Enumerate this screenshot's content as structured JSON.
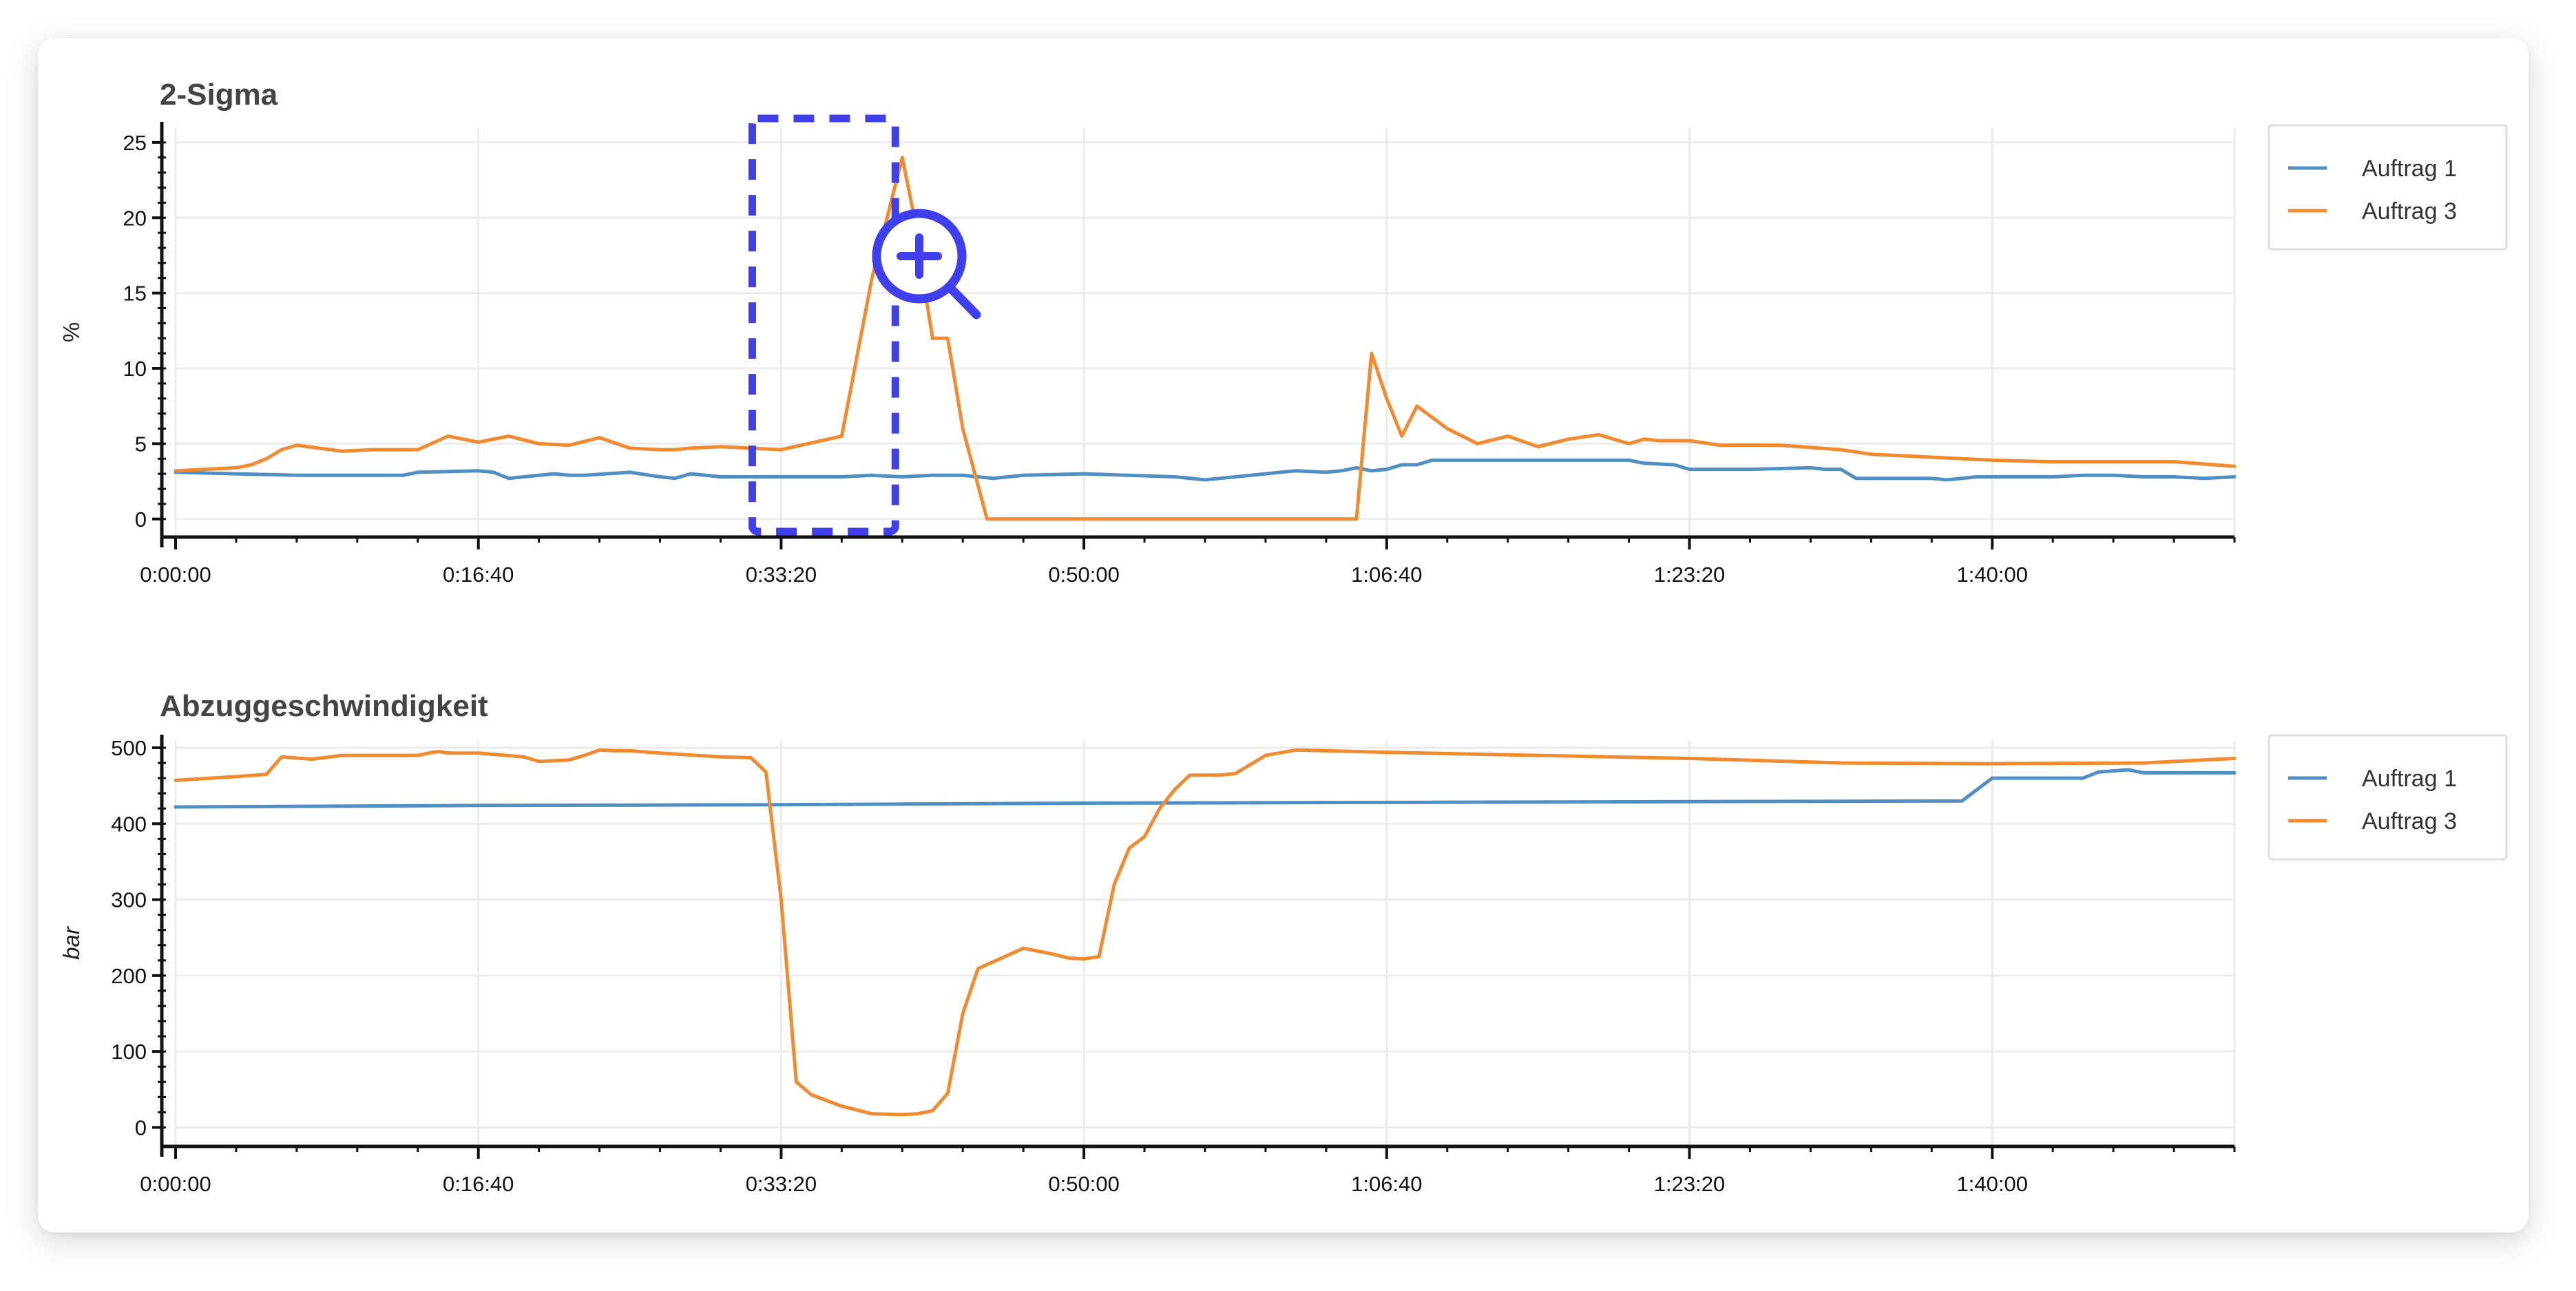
{
  "colors": {
    "series": [
      "#4f8fc4",
      "#f28a30"
    ],
    "grid": "#ececec",
    "axis": "#111111",
    "zoom_overlay": "#3f3fee"
  },
  "icons": [
    "zoom-in-icon"
  ],
  "chart_data": [
    {
      "type": "line",
      "title": "2-Sigma",
      "xlabel": "",
      "ylabel": "%",
      "ylabel_style": "normal",
      "xlim": [
        0,
        6800
      ],
      "ylim": [
        -1.2,
        26
      ],
      "x_ticks": [
        0,
        1000,
        2000,
        3000,
        4000,
        5000,
        6000
      ],
      "x_tick_labels": [
        "0:00:00",
        "0:16:40",
        "0:33:20",
        "0:50:00",
        "1:06:40",
        "1:23:20",
        "1:40:00"
      ],
      "y_ticks": [
        0,
        5,
        10,
        15,
        20,
        25
      ],
      "y_tick_labels": [
        "0",
        "5",
        "10",
        "15",
        "20",
        "25"
      ],
      "grid": true,
      "legend_position": "right",
      "series": [
        {
          "name": "Auftrag 1",
          "x": [
            0,
            400,
            750,
            800,
            1000,
            1050,
            1100,
            1250,
            1300,
            1350,
            1500,
            1600,
            1650,
            1700,
            1800,
            1900,
            2000,
            2200,
            2300,
            2400,
            2500,
            2600,
            2700,
            2800,
            3000,
            3300,
            3400,
            3600,
            3650,
            3700,
            3800,
            3850,
            3900,
            3950,
            4000,
            4050,
            4100,
            4150,
            4500,
            4800,
            4850,
            4950,
            5000,
            5200,
            5400,
            5450,
            5500,
            5550,
            5800,
            5850,
            5900,
            5950,
            6200,
            6300,
            6400,
            6500,
            6550,
            6600,
            6700,
            6800
          ],
          "y": [
            3.1,
            2.9,
            2.9,
            3.1,
            3.2,
            3.1,
            2.7,
            3.0,
            2.9,
            2.9,
            3.1,
            2.8,
            2.7,
            3.0,
            2.8,
            2.8,
            2.8,
            2.8,
            2.9,
            2.8,
            2.9,
            2.9,
            2.7,
            2.9,
            3.0,
            2.8,
            2.6,
            3.0,
            3.1,
            3.2,
            3.1,
            3.2,
            3.4,
            3.2,
            3.3,
            3.6,
            3.6,
            3.9,
            3.9,
            3.9,
            3.7,
            3.6,
            3.3,
            3.3,
            3.4,
            3.3,
            3.3,
            2.7,
            2.7,
            2.6,
            2.7,
            2.8,
            2.8,
            2.9,
            2.9,
            2.8,
            2.8,
            2.8,
            2.7,
            2.8
          ]
        },
        {
          "name": "Auftrag 3",
          "x": [
            0,
            200,
            250,
            300,
            350,
            400,
            550,
            650,
            800,
            900,
            1000,
            1100,
            1200,
            1300,
            1400,
            1500,
            1600,
            1650,
            1700,
            1800,
            2000,
            2200,
            2300,
            2400,
            2450,
            2480,
            2500,
            2550,
            2600,
            2680,
            2800,
            3000,
            3500,
            3900,
            3950,
            4000,
            4050,
            4100,
            4200,
            4300,
            4400,
            4500,
            4600,
            4700,
            4800,
            4850,
            4900,
            5000,
            5100,
            5300,
            5500,
            5600,
            6000,
            6200,
            6400,
            6600,
            6800
          ],
          "y": [
            3.2,
            3.4,
            3.6,
            4.0,
            4.6,
            4.9,
            4.5,
            4.6,
            4.6,
            5.5,
            5.1,
            5.5,
            5.0,
            4.9,
            5.4,
            4.7,
            4.6,
            4.6,
            4.7,
            4.8,
            4.6,
            5.5,
            16.0,
            24.0,
            19.0,
            14.5,
            12.0,
            12.0,
            6.0,
            0.0,
            0.0,
            0.0,
            0.0,
            0.0,
            11.0,
            8.0,
            5.5,
            7.5,
            6.0,
            5.0,
            5.5,
            4.8,
            5.3,
            5.6,
            5.0,
            5.3,
            5.2,
            5.2,
            4.9,
            4.9,
            4.6,
            4.3,
            3.9,
            3.8,
            3.8,
            3.8,
            3.5
          ]
        }
      ]
    },
    {
      "type": "line",
      "title": "Abzuggeschwindigkeit",
      "xlabel": "",
      "ylabel": "bar",
      "ylabel_style": "italic",
      "xlim": [
        0,
        6800
      ],
      "ylim": [
        -25,
        510
      ],
      "x_ticks": [
        0,
        1000,
        2000,
        3000,
        4000,
        5000,
        6000
      ],
      "x_tick_labels": [
        "0:00:00",
        "0:16:40",
        "0:33:20",
        "0:50:00",
        "1:06:40",
        "1:23:20",
        "1:40:00"
      ],
      "y_ticks": [
        0,
        100,
        200,
        300,
        400,
        500
      ],
      "y_tick_labels": [
        "0",
        "100",
        "200",
        "300",
        "400",
        "500"
      ],
      "grid": true,
      "legend_position": "right",
      "series": [
        {
          "name": "Auftrag 1",
          "x": [
            0,
            1000,
            2000,
            3000,
            4000,
            5000,
            5900,
            6000,
            6300,
            6350,
            6450,
            6500,
            6800
          ],
          "y": [
            422,
            424,
            425,
            427,
            428,
            429,
            430,
            460,
            460,
            468,
            471,
            467,
            467
          ]
        },
        {
          "name": "Auftrag 3",
          "x": [
            0,
            200,
            300,
            350,
            450,
            550,
            600,
            800,
            850,
            870,
            900,
            1000,
            1150,
            1200,
            1300,
            1350,
            1400,
            1450,
            1500,
            1600,
            1800,
            1900,
            1950,
            2000,
            2050,
            2100,
            2200,
            2300,
            2400,
            2450,
            2500,
            2550,
            2600,
            2650,
            2800,
            2900,
            2950,
            3000,
            3050,
            3100,
            3150,
            3200,
            3250,
            3300,
            3350,
            3400,
            3450,
            3500,
            3600,
            3700,
            3800,
            4000,
            4500,
            5000,
            5500,
            6000,
            6500,
            6800
          ],
          "y": [
            457,
            462,
            465,
            488,
            485,
            490,
            490,
            490,
            494,
            495,
            493,
            493,
            488,
            482,
            484,
            490,
            497,
            496,
            496,
            493,
            488,
            487,
            468,
            300,
            60,
            43,
            28,
            18,
            17,
            18,
            22,
            45,
            150,
            209,
            236,
            228,
            223,
            222,
            225,
            320,
            368,
            383,
            420,
            445,
            464,
            464,
            464,
            466,
            490,
            497,
            496,
            494,
            490,
            486,
            480,
            479,
            480,
            486
          ]
        }
      ]
    }
  ],
  "annotation": {
    "type": "zoom-box",
    "x_range": [
      1900,
      2400
    ],
    "y_range": [
      -1.2,
      26
    ],
    "panel": 0
  }
}
